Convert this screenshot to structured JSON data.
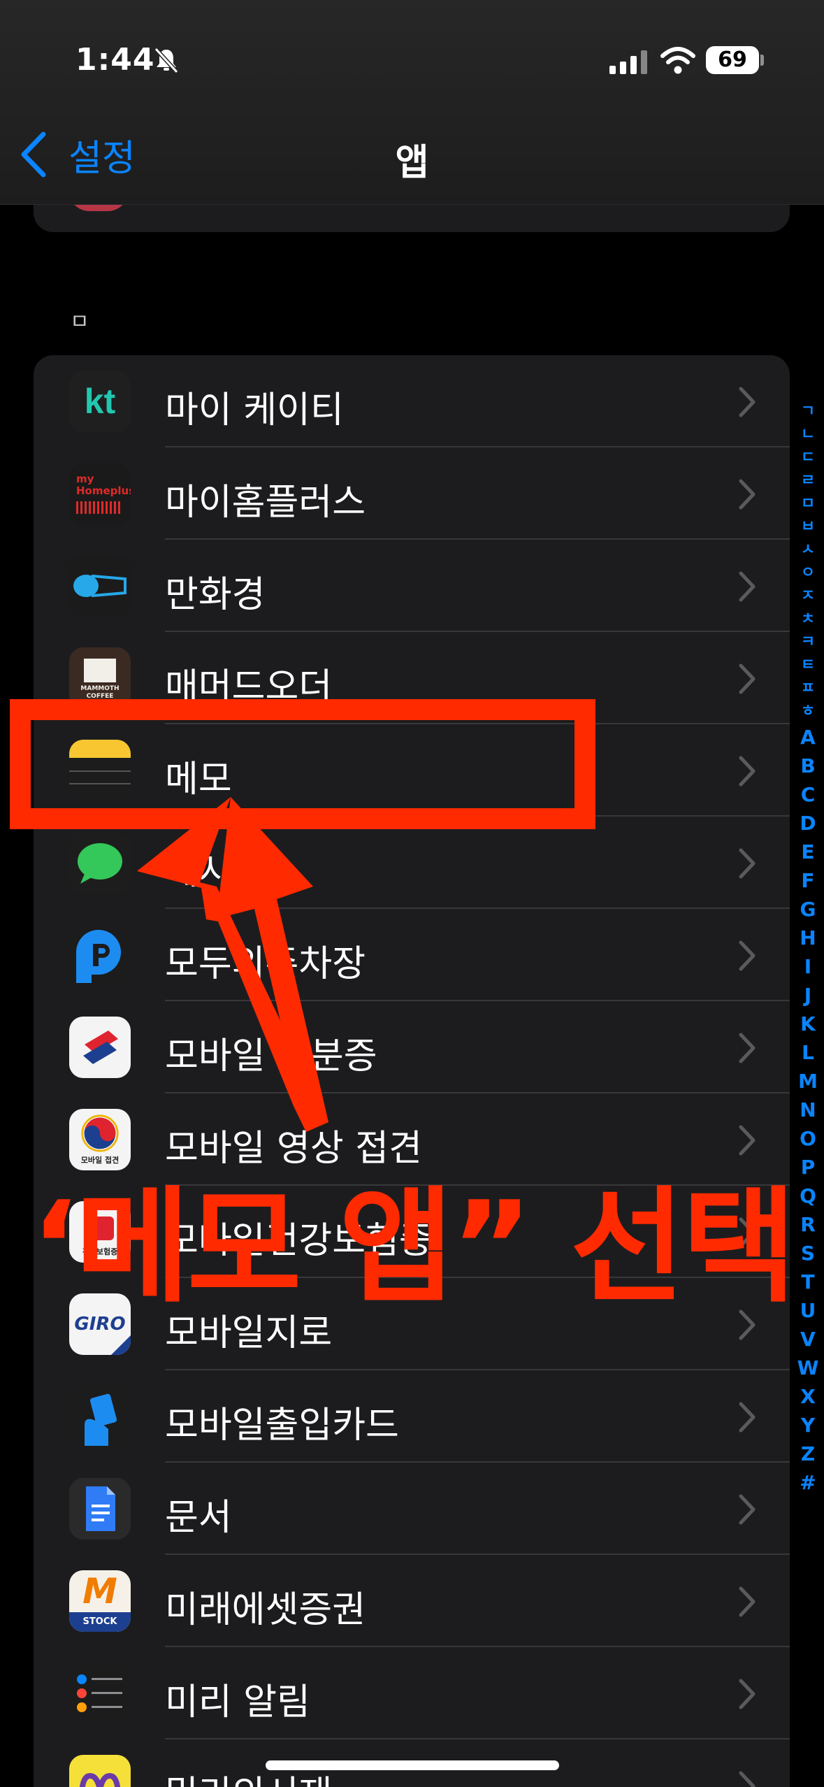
{
  "status_bar": {
    "time": "1:44",
    "battery": "69"
  },
  "nav": {
    "back_label": "설정",
    "title": "앱"
  },
  "section_letter": "ㅁ",
  "rows": [
    {
      "label": "마이 케이티",
      "icon": "kt-icon"
    },
    {
      "label": "마이홈플러스",
      "icon": "homeplus-icon"
    },
    {
      "label": "만화경",
      "icon": "manhwagyeong-icon"
    },
    {
      "label": "매머드오더",
      "icon": "mammoth-coffee-icon"
    },
    {
      "label": "메모",
      "icon": "notes-icon"
    },
    {
      "label": "메시지",
      "icon": "messages-icon"
    },
    {
      "label": "모두의주차장",
      "icon": "parking-icon"
    },
    {
      "label": "모바일 신분증",
      "icon": "mobile-id-icon"
    },
    {
      "label": "모바일 영상 접견",
      "icon": "video-visit-icon"
    },
    {
      "label": "모바일건강보험증",
      "icon": "health-insurance-icon"
    },
    {
      "label": "모바일지로",
      "icon": "giro-icon"
    },
    {
      "label": "모바일출입카드",
      "icon": "access-card-icon"
    },
    {
      "label": "문서",
      "icon": "docs-icon"
    },
    {
      "label": "미래에셋증권",
      "icon": "mirae-asset-icon"
    },
    {
      "label": "미리 알림",
      "icon": "reminders-icon"
    },
    {
      "label": "밀리의서재",
      "icon": "millie-icon"
    }
  ],
  "icon_texts": {
    "kt": "kt",
    "homeplus": "my Homeplus",
    "mammoth": "MAMMOTH COFFEE",
    "video_visit": "모바일 접견",
    "health": "건강보험증",
    "giro": "GIRO",
    "mirae": "M",
    "mirae_sub": "STOCK"
  },
  "index_korean": [
    "ㄱ",
    "ㄴ",
    "ㄷ",
    "ㄹ",
    "ㅁ",
    "ㅂ",
    "ㅅ",
    "ㅇ",
    "ㅈ",
    "ㅊ",
    "ㅋ",
    "ㅌ",
    "ㅍ",
    "ㅎ"
  ],
  "index_latin": [
    "A",
    "B",
    "C",
    "D",
    "E",
    "F",
    "G",
    "H",
    "I",
    "J",
    "K",
    "L",
    "M",
    "N",
    "O",
    "P",
    "Q",
    "R",
    "S",
    "T",
    "U",
    "V",
    "W",
    "X",
    "Y",
    "Z",
    "#"
  ],
  "annotation": {
    "caption": "‘메모 앱” 선택",
    "color": "#ff2a00"
  },
  "colors": {
    "accent": "#0a84ff",
    "background": "#000000",
    "cell": "#1c1c1e"
  }
}
